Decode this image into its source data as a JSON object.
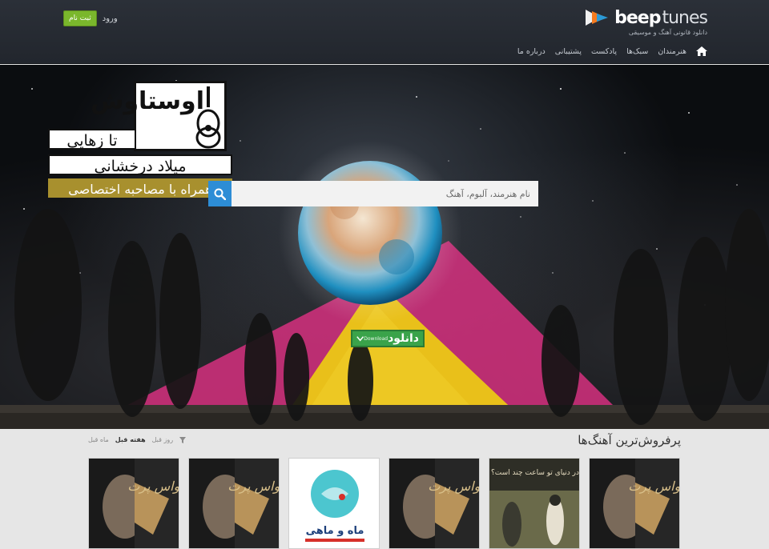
{
  "header": {
    "logo_beep": "beep",
    "logo_tunes": "tunes",
    "tagline": "دانلود قانونی آهنگ و موسیقی",
    "register_label": "ثبت نام",
    "login_label": "ورود",
    "nav": [
      "هنرمندان",
      "سبک‌ها",
      "پادکست",
      "پشتیبانی",
      "درباره ما"
    ],
    "home_icon": "home-icon"
  },
  "hero": {
    "promo": {
      "title_big": "اوستاوش",
      "line1": "تا زهایی",
      "line2": "میلاد درخشانی",
      "line3": "همراه با مصاحبه اختصاصی"
    },
    "search": {
      "placeholder": "نام هنرمند، آلبوم، آهنگ",
      "icon": "search-icon"
    },
    "download": {
      "label": "دانلود",
      "small": "Download"
    }
  },
  "best_sellers": {
    "title": "پرفروش‌ترین آهنگ‌ها",
    "filters": [
      "روز قبل",
      "هفته قبل",
      "ماه قبل"
    ],
    "active_filter": "هفته قبل",
    "card4_title": "ماه و ماهی",
    "card5_title": "در دنیای تو ساعت چند است؟",
    "card_titles_short": "حواس پرت"
  },
  "colors": {
    "accent_green": "#7ab72c",
    "search_blue": "#2d8dd6",
    "download_green": "#3aa34a",
    "header_dark": "#262a31",
    "promo_gold": "#a8902e"
  }
}
